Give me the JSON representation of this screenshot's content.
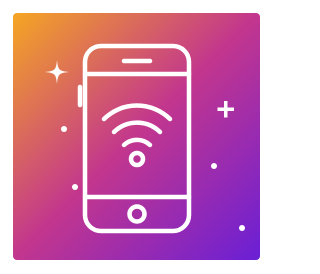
{
  "icon": {
    "name": "smartphone-wifi-icon",
    "colors": {
      "gradient_start": "#F5A623",
      "gradient_mid": "#C2368E",
      "gradient_end": "#6A1FD6",
      "stroke": "#FFFFFF"
    }
  }
}
